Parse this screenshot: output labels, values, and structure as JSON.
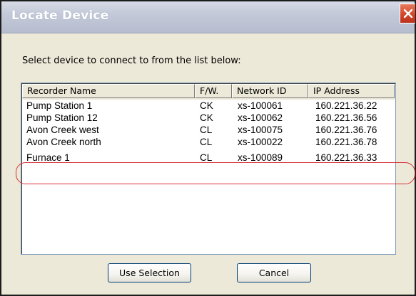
{
  "window": {
    "title": "Locate Device",
    "close_icon": "close-icon"
  },
  "instruction": "Select device to connect to from the list below:",
  "list": {
    "columns": [
      "Recorder Name",
      "F/W.",
      "Network ID",
      "IP Address"
    ],
    "rows": [
      {
        "name": "Pump Station 1",
        "fw": "CK",
        "network_id": "xs-100061",
        "ip": "160.221.36.22"
      },
      {
        "name": "Pump Station 12",
        "fw": "CK",
        "network_id": "xs-100062",
        "ip": "160.221.36.56"
      },
      {
        "name": "Avon Creek west",
        "fw": "CL",
        "network_id": "xs-100075",
        "ip": "160.221.36.76"
      },
      {
        "name": "Avon Creek north",
        "fw": "CL",
        "network_id": "xs-100022",
        "ip": "160.221.36.78"
      },
      {
        "name": "Furnace 1",
        "fw": "CL",
        "network_id": "xs-100089",
        "ip": "160.221.36.33"
      }
    ],
    "highlighted_row": "Furnace 1",
    "highlight_color": "#d8303a"
  },
  "buttons": {
    "use_selection": "Use Selection",
    "cancel": "Cancel"
  },
  "colors": {
    "dialog_bg": "#ece9d8",
    "close_button": "#d3472a",
    "border": "#7f9db9"
  }
}
